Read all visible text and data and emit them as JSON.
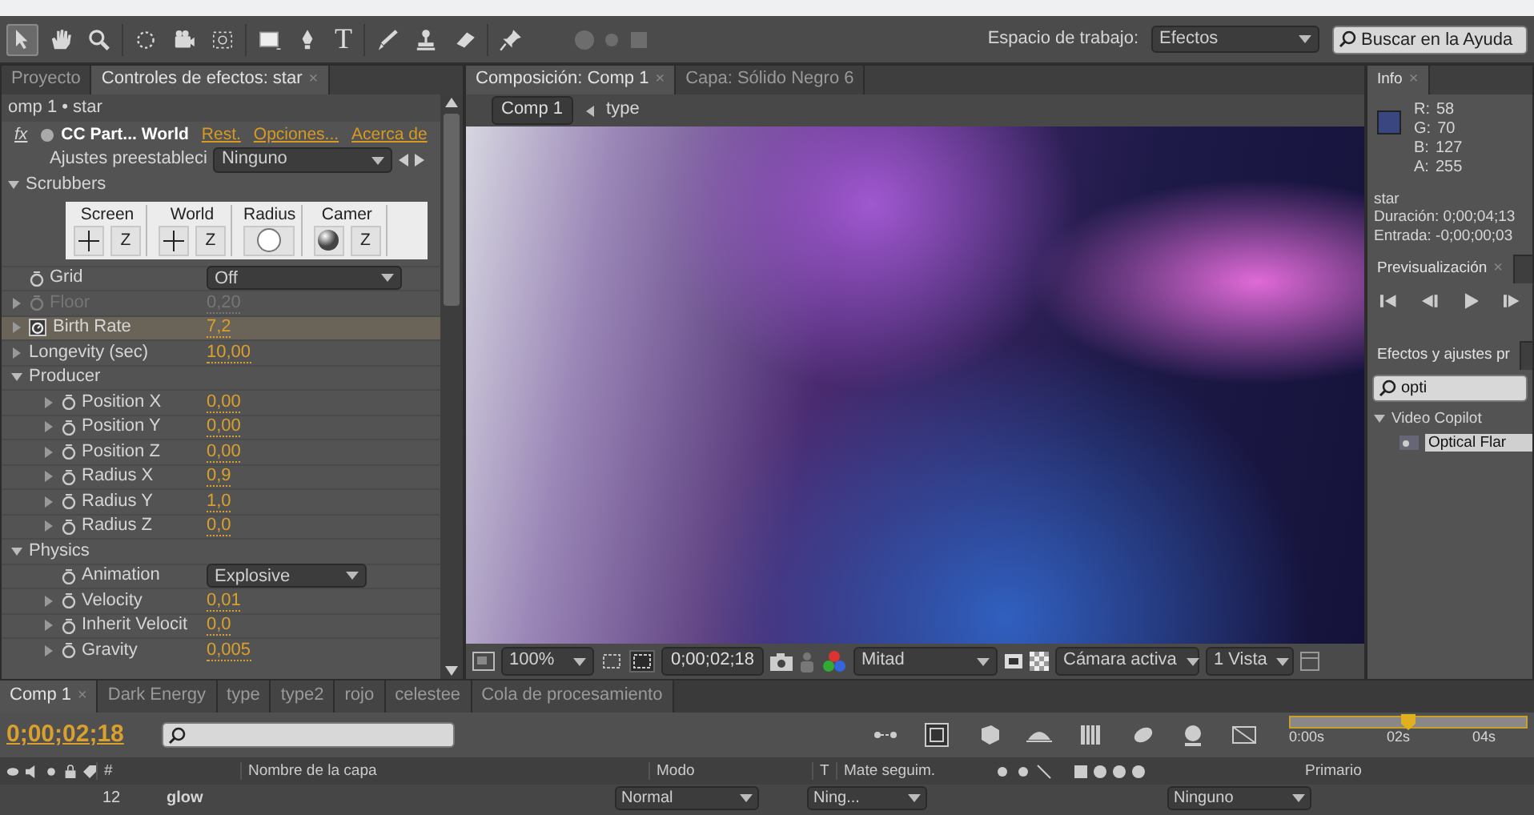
{
  "top_toolbar": {
    "tools": [
      {
        "kind": "arrow",
        "selected": true
      },
      {
        "kind": "hand",
        "selected": false
      },
      {
        "kind": "zoom",
        "selected": false
      },
      {
        "kind": "rotate",
        "selected": false
      },
      {
        "kind": "camera",
        "selected": false
      },
      {
        "kind": "pan_behind",
        "selected": false
      },
      {
        "kind": "rectangle",
        "selected": false
      },
      {
        "kind": "pen",
        "selected": false
      },
      {
        "kind": "text",
        "glyph": "T",
        "selected": false
      },
      {
        "kind": "brush",
        "selected": false
      },
      {
        "kind": "stamp",
        "selected": false
      },
      {
        "kind": "eraser",
        "selected": false
      },
      {
        "kind": "pin",
        "selected": false
      }
    ],
    "workspace": {
      "label": "Espacio de trabajo:",
      "value": "Efectos"
    },
    "help_search": {
      "placeholder": "Buscar en la Ayuda"
    }
  },
  "effect_controls": {
    "tabs": [
      {
        "label": "Proyecto",
        "selected": false
      },
      {
        "label": "Controles de efectos: star",
        "selected": true,
        "close": "×"
      }
    ],
    "breadcrumb": "omp 1 • star",
    "effect": {
      "fx": "fx",
      "name": "CC Part... World",
      "links": [
        "Rest.",
        "Opciones...",
        "Acerca de"
      ]
    },
    "preset": {
      "label": "Ajustes preestableci",
      "value": "Ninguno"
    },
    "scrubbers": {
      "label": "Scrubbers",
      "expanded": true,
      "groups": [
        {
          "label": "Screen",
          "controls": [
            {
              "kind": "cross"
            },
            {
              "kind": "key",
              "text": "Z"
            }
          ]
        },
        {
          "label": "World",
          "controls": [
            {
              "kind": "cross"
            },
            {
              "kind": "key",
              "text": "Z"
            }
          ]
        },
        {
          "label": "Radius",
          "controls": [
            {
              "kind": "circle"
            }
          ]
        },
        {
          "label": "Camer",
          "controls": [
            {
              "kind": "sphere"
            },
            {
              "kind": "key",
              "text": "Z"
            }
          ]
        }
      ]
    },
    "properties": [
      {
        "kind": "dropdown",
        "name": "Grid",
        "value": "Off",
        "stopwatch": true,
        "keyframed": false,
        "disabled": false,
        "selected": false
      },
      {
        "kind": "value",
        "name": "Floor",
        "value": "0,20",
        "stopwatch": true,
        "keyframed": false,
        "disabled": true,
        "selected": false
      },
      {
        "kind": "value",
        "name": "Birth Rate",
        "value": "7,2",
        "stopwatch": true,
        "keyframed": true,
        "disabled": false,
        "selected": true
      },
      {
        "kind": "value",
        "name": "Longevity (sec)",
        "value": "10,00",
        "stopwatch": false,
        "keyframed": false,
        "disabled": false,
        "selected": false
      },
      {
        "kind": "group",
        "name": "Producer",
        "expanded": true,
        "children": [
          {
            "kind": "value",
            "name": "Position X",
            "value": "0,00",
            "stopwatch": true,
            "keyframed": false,
            "disabled": false,
            "selected": false
          },
          {
            "kind": "value",
            "name": "Position Y",
            "value": "0,00",
            "stopwatch": true,
            "keyframed": false,
            "disabled": false,
            "selected": false
          },
          {
            "kind": "value",
            "name": "Position Z",
            "value": "0,00",
            "stopwatch": true,
            "keyframed": false,
            "disabled": false,
            "selected": false
          },
          {
            "kind": "value",
            "name": "Radius X",
            "value": "0,9",
            "stopwatch": true,
            "keyframed": false,
            "disabled": false,
            "selected": false
          },
          {
            "kind": "value",
            "name": "Radius Y",
            "value": "1,0",
            "stopwatch": true,
            "keyframed": false,
            "disabled": false,
            "selected": false
          },
          {
            "kind": "value",
            "name": "Radius Z",
            "value": "0,0",
            "stopwatch": true,
            "keyframed": false,
            "disabled": false,
            "selected": false
          }
        ]
      },
      {
        "kind": "group",
        "name": "Physics",
        "expanded": true,
        "children": [
          {
            "kind": "dropdown",
            "name": "Animation",
            "value": "Explosive",
            "stopwatch": true,
            "keyframed": false,
            "disabled": false,
            "selected": false
          },
          {
            "kind": "value",
            "name": "Velocity",
            "value": "0,01",
            "stopwatch": true,
            "keyframed": false,
            "disabled": false,
            "selected": false
          },
          {
            "kind": "value",
            "name": "Inherit Velocit",
            "value": "0,0",
            "stopwatch": true,
            "keyframed": false,
            "disabled": false,
            "selected": false
          },
          {
            "kind": "value",
            "name": "Gravity",
            "value": "0,005",
            "stopwatch": true,
            "keyframed": false,
            "disabled": false,
            "selected": false
          }
        ]
      }
    ]
  },
  "composition": {
    "tabs": [
      {
        "label": "Composición: Comp 1",
        "selected": true,
        "close": "×"
      },
      {
        "label": "Capa: Sólido Negro 6",
        "selected": false
      }
    ],
    "breadcrumb": [
      {
        "label": "Comp 1",
        "selected": true
      },
      {
        "label": "type",
        "selected": false
      }
    ],
    "footer": {
      "zoom": "100%",
      "timecode": "0;00;02;18",
      "resolution": "Mitad",
      "camera": "Cámara activa",
      "views": "1 Vista"
    }
  },
  "info": {
    "tab": "Info",
    "tab_close": "×",
    "channels": [
      {
        "label": "R:",
        "value": "58"
      },
      {
        "label": "G:",
        "value": "70"
      },
      {
        "label": "B:",
        "value": "127"
      },
      {
        "label": "A:",
        "value": "255"
      }
    ],
    "layer": "star",
    "duration": "Duración: 0;00;04;13",
    "in_point": "Entrada: -0;00;00;03"
  },
  "preview": {
    "tab": "Previsualización",
    "tab_close": "×"
  },
  "effects_presets": {
    "tab": "Efectos y ajustes pr",
    "search_value": "opti",
    "tree": [
      {
        "label": "Video Copilot",
        "expanded": true,
        "selected": false,
        "children": [
          {
            "label": "Optical Flar",
            "selected": true
          }
        ]
      }
    ]
  },
  "timeline": {
    "tabs": [
      {
        "label": "Comp 1",
        "selected": true,
        "close": "×"
      },
      {
        "label": "Dark Energy",
        "selected": false
      },
      {
        "label": "type",
        "selected": false
      },
      {
        "label": "type2",
        "selected": false
      },
      {
        "label": "rojo",
        "selected": false
      },
      {
        "label": "celestee",
        "selected": false
      },
      {
        "label": "Cola de procesamiento",
        "selected": false
      }
    ],
    "timecode": "0;00;02;18",
    "columns": [
      "#",
      "Nombre de la capa",
      "Modo",
      "T",
      "Mate seguim.",
      "Primario"
    ],
    "ruler": [
      "0:00s",
      "02s",
      "04s"
    ],
    "layers": [
      {
        "number": "12",
        "name": "glow",
        "mode": "Normal",
        "matte": "Ning...",
        "parent": "Ninguno"
      }
    ]
  }
}
